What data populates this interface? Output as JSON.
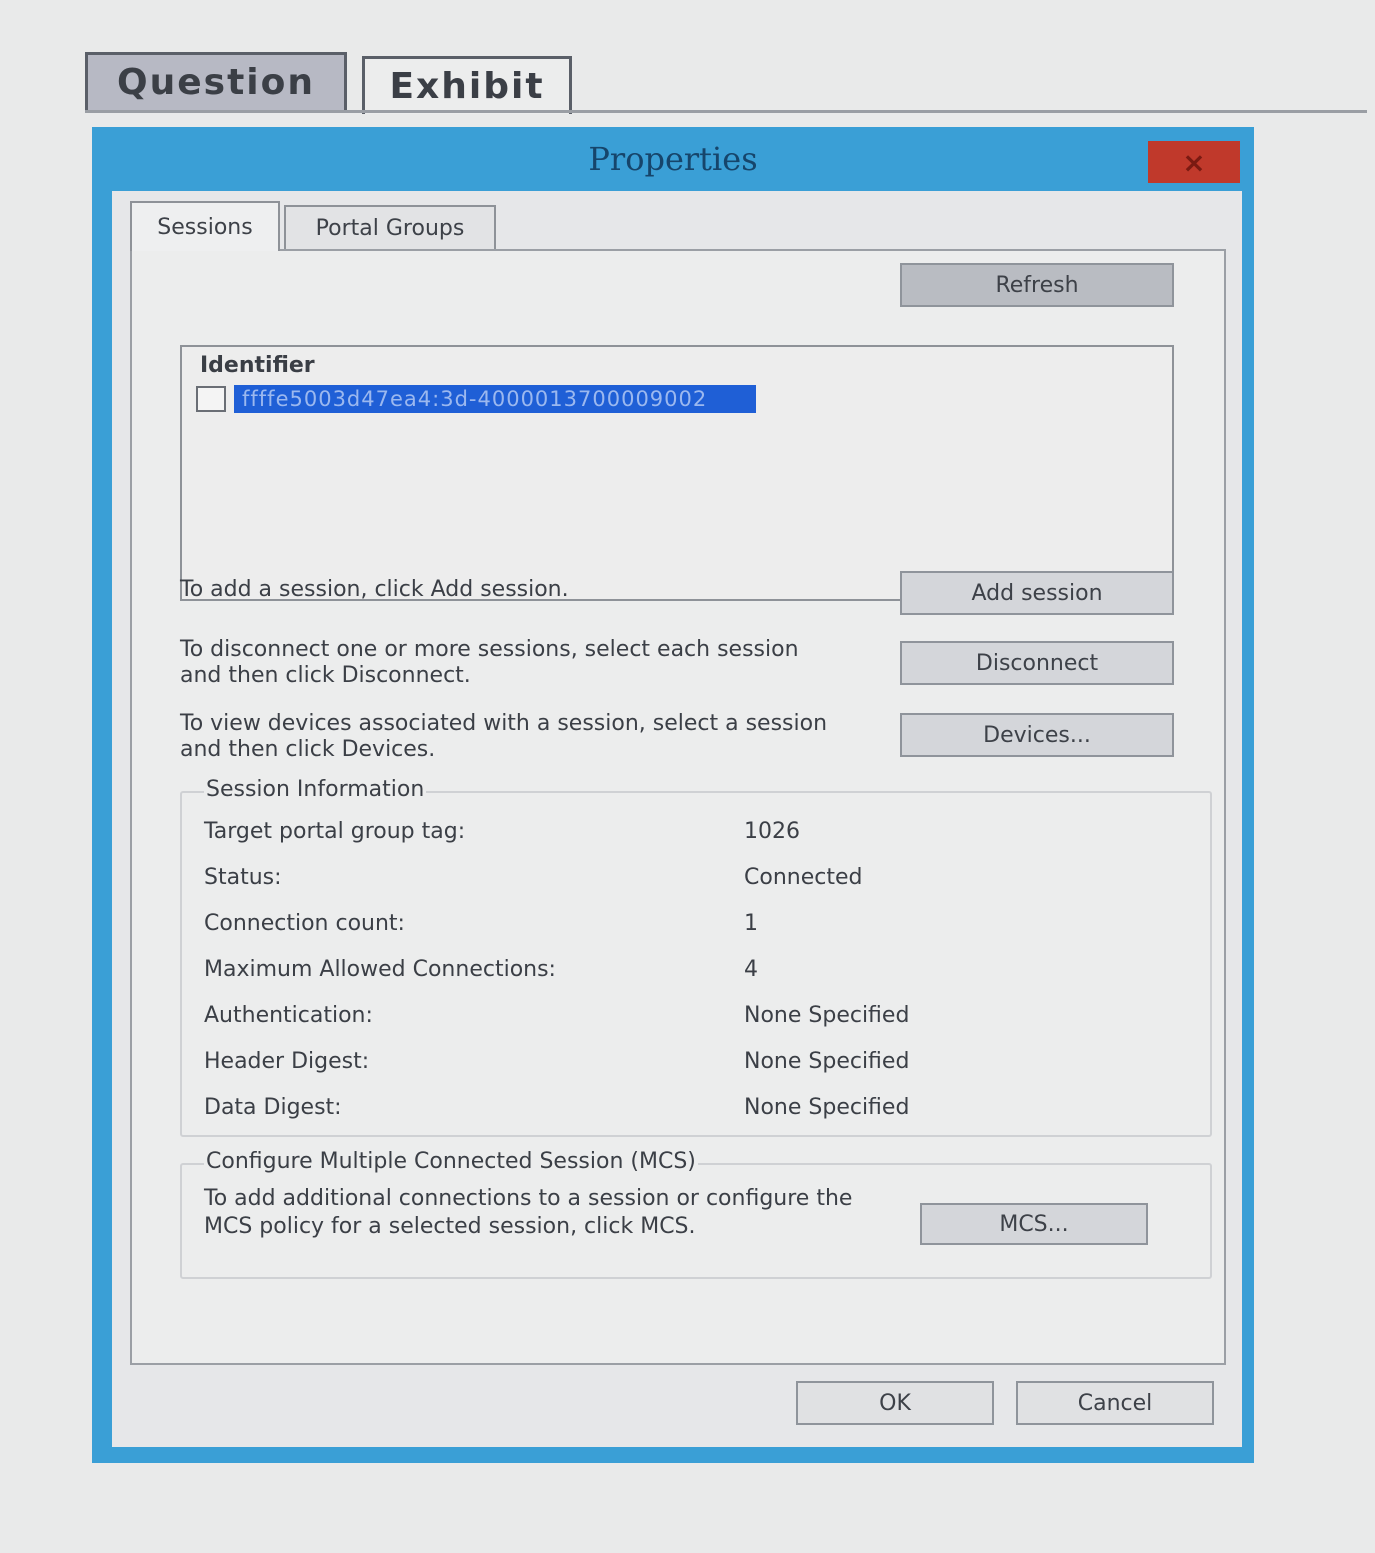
{
  "outer_tabs": {
    "question": "Question",
    "exhibit": "Exhibit"
  },
  "dialog": {
    "title": "Properties",
    "close": "×",
    "tabs": {
      "sessions": "Sessions",
      "portal_groups": "Portal Groups"
    },
    "refresh_label": "Refresh",
    "list": {
      "header": "Identifier",
      "item": "ffffe5003d47ea4:3d-4000013700009002"
    },
    "instructions": {
      "add": "To add a session, click Add session.",
      "disconnect": "To disconnect one or more sessions, select each session and then click Disconnect.",
      "devices": "To view devices associated with a session, select a session and then click Devices."
    },
    "buttons": {
      "add_session": "Add session",
      "disconnect": "Disconnect",
      "devices": "Devices...",
      "mcs": "MCS...",
      "ok": "OK",
      "cancel": "Cancel"
    },
    "session_info": {
      "title": "Session Information",
      "rows": [
        {
          "label": "Target portal group tag:",
          "value": "1026"
        },
        {
          "label": "Status:",
          "value": "Connected"
        },
        {
          "label": "Connection count:",
          "value": "1"
        },
        {
          "label": "Maximum Allowed Connections:",
          "value": "4"
        },
        {
          "label": "Authentication:",
          "value": "None Specified"
        },
        {
          "label": "Header Digest:",
          "value": "None Specified"
        },
        {
          "label": "Data Digest:",
          "value": "None Specified"
        }
      ]
    },
    "mcs_group": {
      "title": "Configure Multiple Connected Session (MCS)",
      "text": "To add additional connections to a session or configure the MCS policy for a selected session, click MCS."
    }
  }
}
